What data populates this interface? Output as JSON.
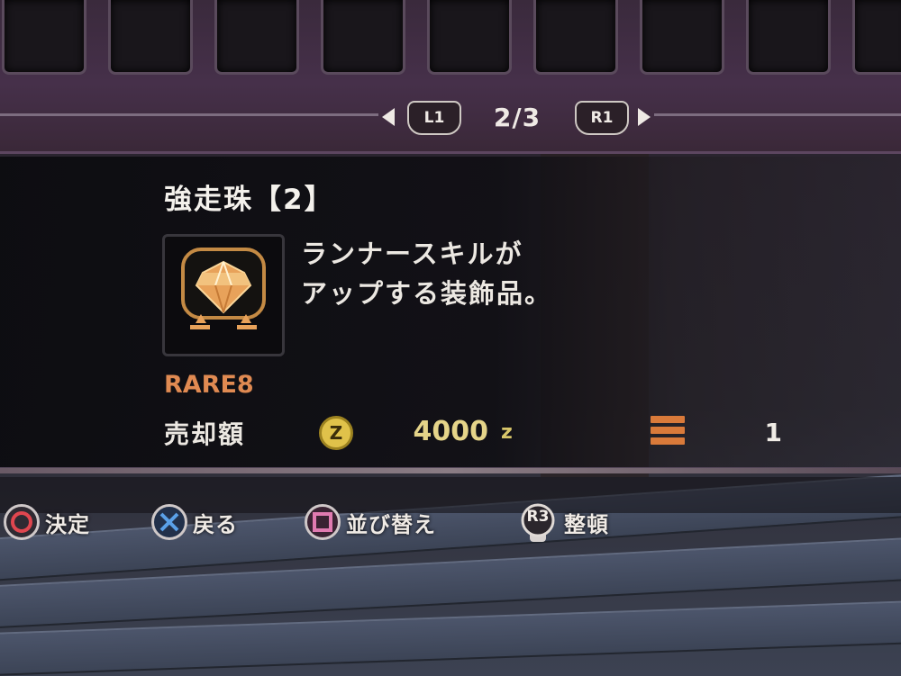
{
  "pager": {
    "left_button": "L1",
    "right_button": "R1",
    "page": "2/3"
  },
  "item": {
    "name": "強走珠【2】",
    "description_line1": "ランナースキルが",
    "description_line2": "アップする装飾品。",
    "rarity": "RARE8",
    "sell_label": "売却額",
    "price": "4000",
    "currency_unit": "z",
    "zenny_symbol": "Z",
    "quantity": "1",
    "icon": "decoration-jewel-icon"
  },
  "hints": [
    {
      "button": "circle-button-icon",
      "label": "決定"
    },
    {
      "button": "cross-button-icon",
      "label": "戻る"
    },
    {
      "button": "square-button-icon",
      "label": "並び替え"
    },
    {
      "button": "r3-stick-icon",
      "text": "R3",
      "label": "整頓"
    }
  ],
  "colors": {
    "rarity": "#e08a52",
    "price": "#e5d489",
    "jewel": "#e8a25a",
    "circle": "#e0464f",
    "cross": "#5aa0e8",
    "square": "#e07ab0"
  }
}
